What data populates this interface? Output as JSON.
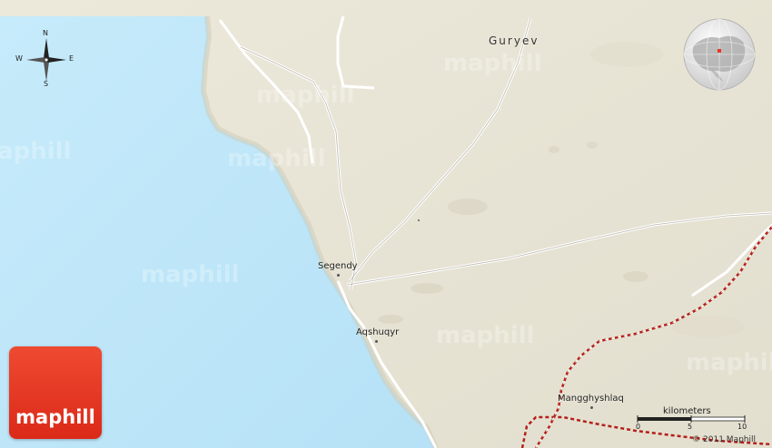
{
  "map": {
    "places": {
      "guryev": "Guryev",
      "segendy": "Segendy",
      "aqshuqyr": "Aqshuqyr",
      "mangghyshlaq": "Mangghyshlaq"
    },
    "watermark": "maphill",
    "compass": {
      "n": "N",
      "s": "S",
      "e": "E",
      "w": "W"
    },
    "logo_text": "maphill",
    "scale": {
      "title": "kilometers",
      "ticks": [
        "0",
        "5",
        "10"
      ]
    },
    "copyright": "© 2011 Maphill",
    "colors": {
      "water": "#bfe6f8",
      "land": "#e9e5d6",
      "road": "#ffffff",
      "rail": "#b3201a",
      "logo": "#e63624"
    }
  }
}
